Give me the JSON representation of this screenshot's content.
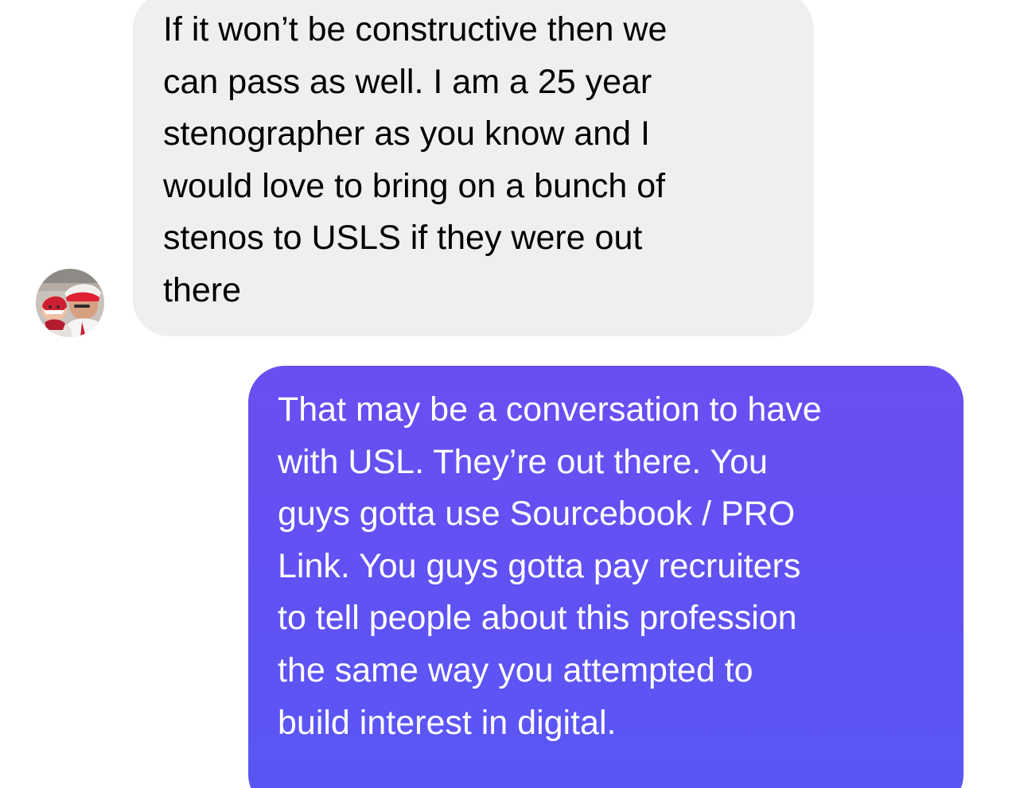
{
  "conversation": {
    "messages": [
      {
        "direction": "incoming",
        "text": "If it won’t be constructive then we\ncan pass as well.  I am a 25 year\nstenographer as you know and I\nwould love to bring on a bunch of\nstenos to USLS if they were out\nthere"
      },
      {
        "direction": "outgoing",
        "text": "That may be a conversation to have\nwith USL.  They’re out there. You\nguys gotta use Sourcebook / PRO\nLink. You guys gotta pay recruiters\nto tell people about this profession\nthe same way you attempted to\nbuild interest in digital."
      }
    ],
    "avatar": {
      "icon": "contact-photo-avatar"
    }
  },
  "colors": {
    "incoming_bubble": "#efefef",
    "outgoing_bubble_top": "#6b4ef2",
    "outgoing_bubble_bottom": "#5957f4",
    "incoming_text": "#000000",
    "outgoing_text": "#ffffff"
  }
}
